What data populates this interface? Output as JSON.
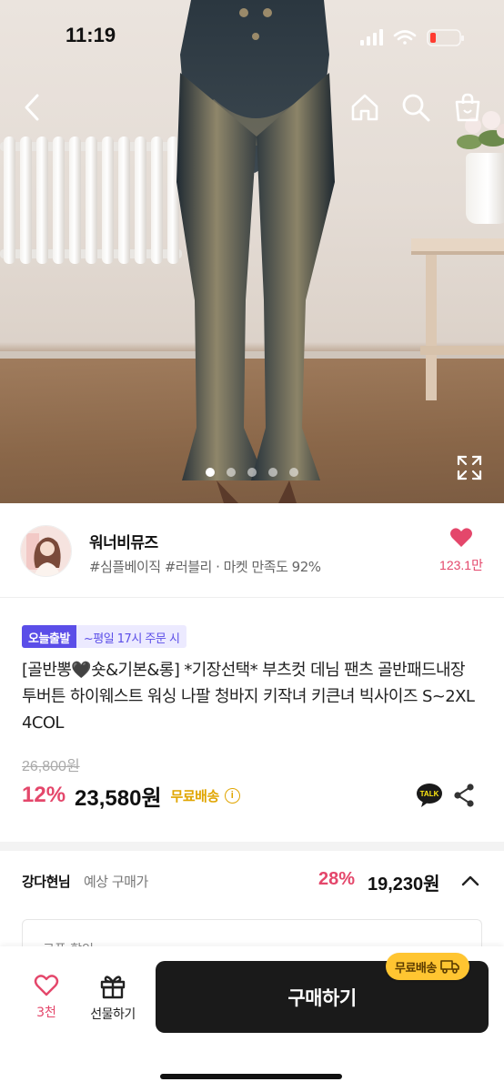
{
  "status_bar": {
    "time": "11:19"
  },
  "shop": {
    "name": "워너비뮤즈",
    "tags": "#심플베이직 #러블리 · 마켓 만족도 92%",
    "like_count": "123.1만"
  },
  "gallery": {
    "dot_count": 5,
    "active_dot": 0
  },
  "product": {
    "badge_today": "오늘출발",
    "badge_order": "~평일 17시 주문 시",
    "title": "[골반뽕🖤숏&기본&롱] *기장선택* 부츠컷 데님 팬츠 골반패드내장 투버튼 하이웨스트 워싱 나팔 청바지 키작녀 키큰녀 빅사이즈 S~2XL 4COL",
    "original_price": "26,800원",
    "discount": "12%",
    "price": "23,580원",
    "free_shipping": "무료배송",
    "talk_label": "TALK"
  },
  "member_price": {
    "name": "강다현님",
    "label": "예상 구매가",
    "discount": "28%",
    "price": "19,230원"
  },
  "coupon_box": {
    "text": "쿠폰 할인"
  },
  "bottom_bar": {
    "like_count": "3천",
    "gift_label": "선물하기",
    "buy_label": "구매하기",
    "shipping_pill": "무료배송"
  },
  "colors": {
    "accent_pink": "#e4476b",
    "brand_purple": "#5b4ee8",
    "free_ship_yellow": "#e0a500",
    "buy_button": "#1a1a1a"
  }
}
